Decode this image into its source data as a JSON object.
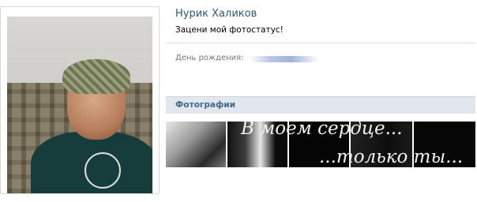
{
  "profile": {
    "name": "Нурик Халиков",
    "status": "Зацени мой фотостатус!",
    "birthday_label": "День рождения:"
  },
  "photos_section": {
    "title": "Фотографии",
    "overlay_line1": "В моем сердце...",
    "overlay_line2": "...только ты..."
  },
  "colors": {
    "link": "#2b587a",
    "section_bg": "#e1e7ed",
    "section_title": "#45688e"
  }
}
